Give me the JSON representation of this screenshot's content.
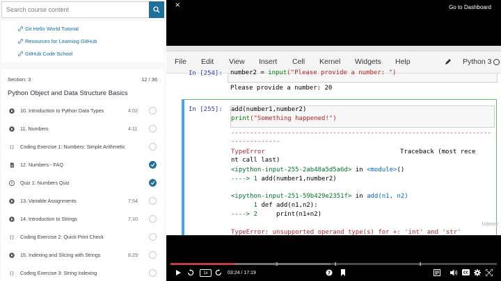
{
  "search": {
    "placeholder": "Search course content"
  },
  "resources": [
    {
      "label": "Git Hello World Tutorial"
    },
    {
      "label": "Resources for Learning GitHub"
    },
    {
      "label": "GitHub Code School"
    }
  ],
  "section": {
    "label": "Section: 3",
    "count": "12 / 36",
    "title": "Python Object and Data Structure Basics",
    "lectures": [
      {
        "type": "video",
        "title": "10. Introduction to Python Data Types",
        "duration": "4:02",
        "completed": false
      },
      {
        "type": "video",
        "title": "11. Numbers",
        "duration": "4:11",
        "completed": false
      },
      {
        "type": "code",
        "title": "Coding Exercise 1: Numbers: Simple Arithmetic",
        "duration": "",
        "completed": false
      },
      {
        "type": "doc",
        "title": "12. Numbers - FAQ",
        "duration": "",
        "completed": true
      },
      {
        "type": "quiz",
        "title": "Quiz 1: Numbers Quiz",
        "duration": "",
        "completed": true
      },
      {
        "type": "video",
        "title": "13. Variable Assignments",
        "duration": "7:54",
        "completed": false
      },
      {
        "type": "video",
        "title": "14. Introduction to Strings",
        "duration": "7:10",
        "completed": false
      },
      {
        "type": "code",
        "title": "Coding Exercise 2: Quick Print Check",
        "duration": "",
        "completed": false
      },
      {
        "type": "video",
        "title": "15. Indexing and Slicing with Strings",
        "duration": "8:29",
        "completed": false
      },
      {
        "type": "code",
        "title": "Coding Exercise 3: String Indexing",
        "duration": "",
        "completed": false
      }
    ]
  },
  "player": {
    "close_label": "×",
    "dashboard_label": "Go to Dashboard",
    "speed_label": "1x",
    "time_readout": "03:24 / 17:19",
    "progress_fraction": 0.196,
    "buffer_fraction": 0.49
  },
  "notebook": {
    "menu": [
      "File",
      "Edit",
      "View",
      "Insert",
      "Cell",
      "Kernel",
      "Widgets",
      "Help"
    ],
    "kernel": "Python 3",
    "cell1_prompt": "In [254]:",
    "cell1_code_plain": "number2 = ",
    "cell1_code_fn": "input",
    "cell1_code_str": "(\"Please provide a number: \")",
    "cell1_output": "Please provide a number: 20",
    "cell2_prompt": "In [255]:",
    "cell2_line1": "add(number1,number2)",
    "cell2_line2_fn": "print",
    "cell2_line2_str": "(\"Something happened!\")",
    "dashes1": "---------------------------------------------------------------------",
    "dashes2": "-------------",
    "error_name": "TypeError",
    "traceback_label": "Traceback (most rece",
    "traceback_cont": "nt call last)",
    "tb1_input": "<ipython-input-255-2ab48a5d5a6d>",
    "tb1_in": " in ",
    "tb1_module": "<module>",
    "tb1_paren": "()",
    "tb1_arrow": "----> 1 ",
    "tb1_code": "add(number1,number2)",
    "tb2_input": "<ipython-input-251-59b429e2351f>",
    "tb2_in": " in ",
    "tb2_func": "add",
    "tb2_args": "(n1, n2)",
    "tb2_line1_num": "      1 ",
    "tb2_line1_code": "def add(n1,n2):",
    "tb2_line2_num": "----> 2 ",
    "tb2_line2_code": "    print(n1+n2)",
    "err_msg": "TypeError: unsupported operand type(s) for +: 'int' and 'str'",
    "watermark": "Udemy"
  }
}
